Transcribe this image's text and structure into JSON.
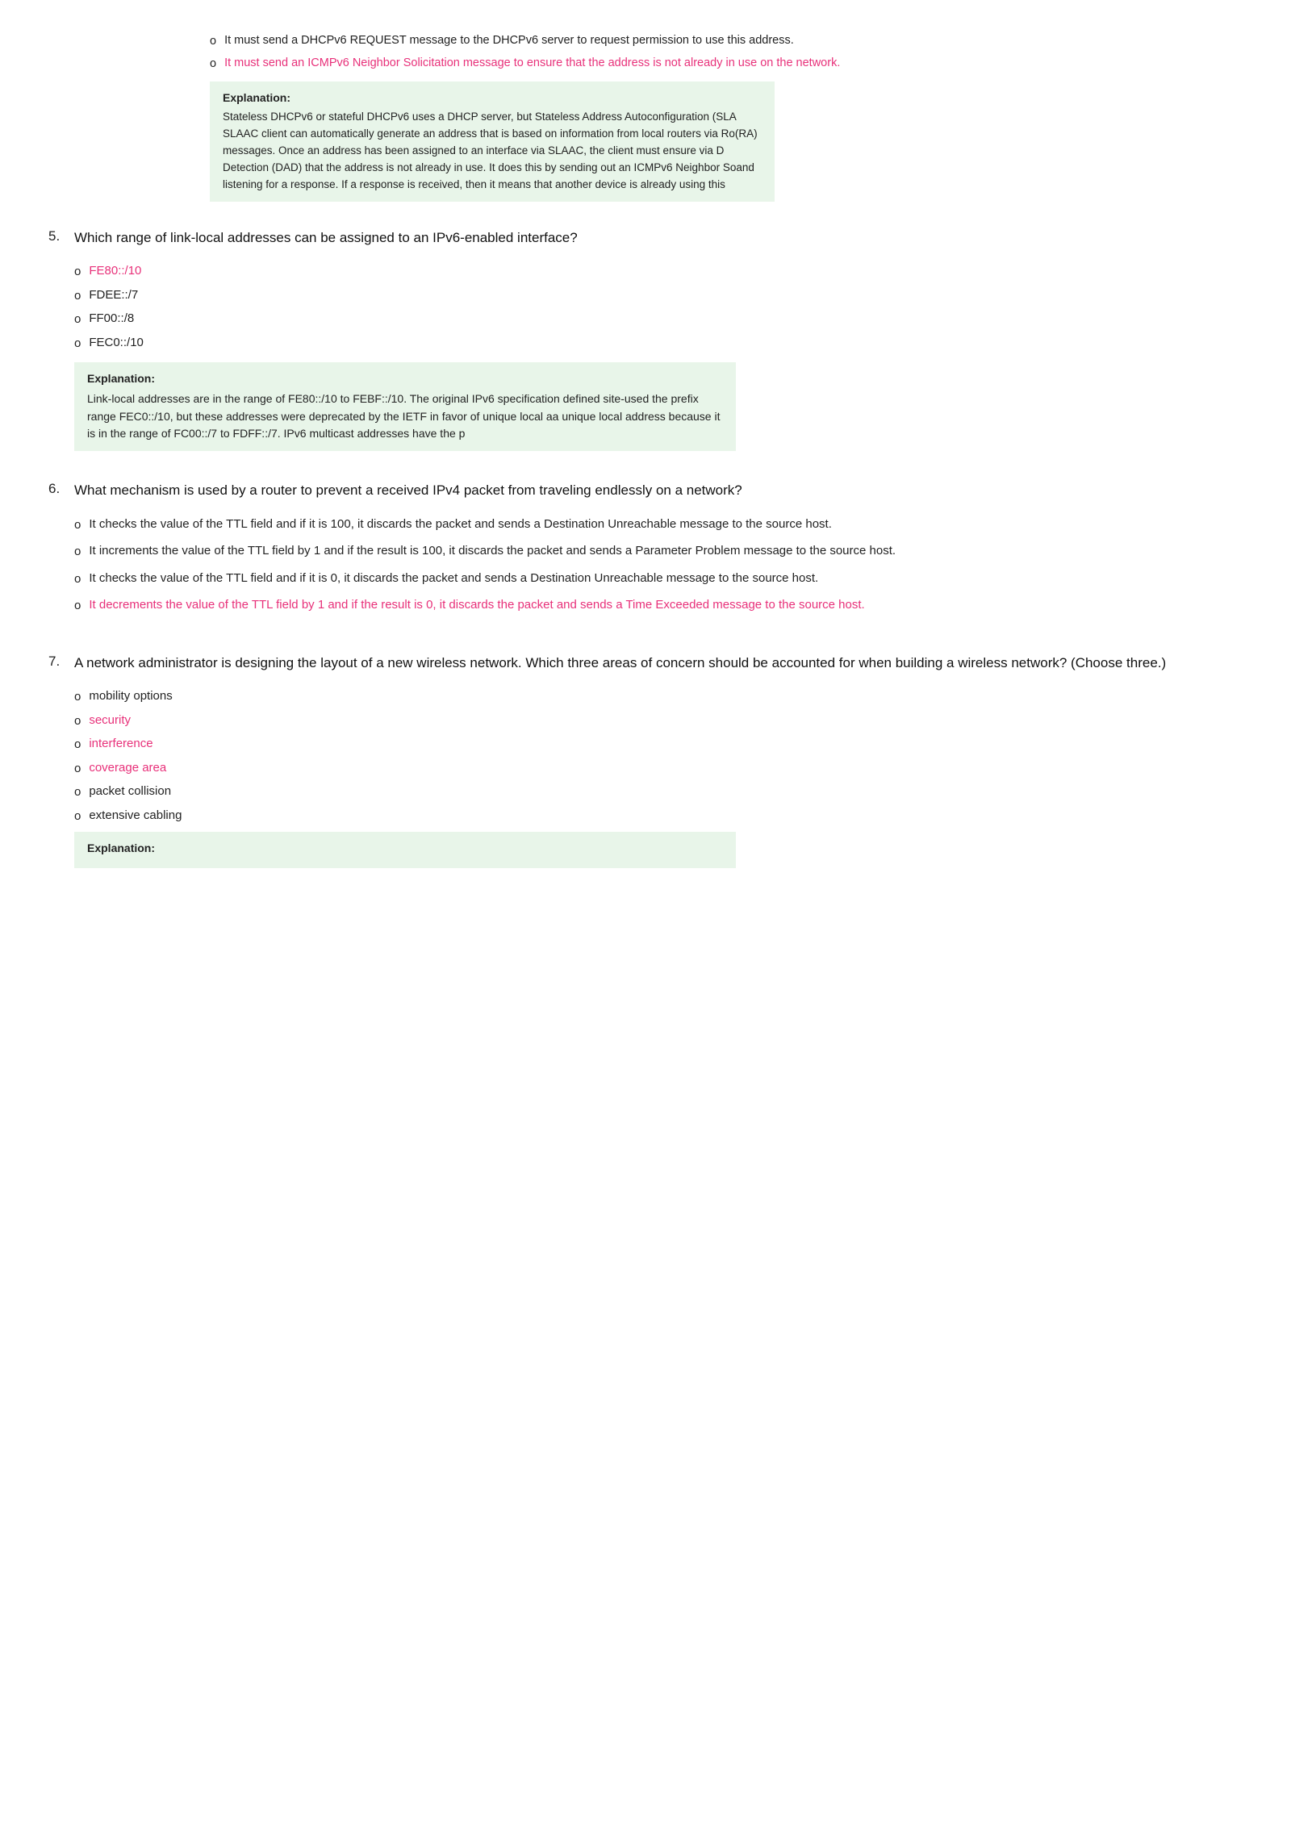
{
  "top_bullets": {
    "items": [
      {
        "id": "b1",
        "text": "It must send a DHCPv6 REQUEST message to the DHCPv6 server to request permission to use this address.",
        "correct": false
      },
      {
        "id": "b2",
        "text": "It must send an ICMPv6 Neighbor Solicitation message to ensure that the address is not already in use on the network.",
        "correct": true
      }
    ],
    "explanation_label": "Explanation:",
    "explanation_text": "Stateless DHCPv6 or stateful DHCPv6 uses a DHCP server, but Stateless Address Autoconfiguration (SLA​​SLAAC client can automatically generate an address that is based on information from local routers via Ro​​(RA) messages. Once an address has been assigned to an interface via SLAAC, the client must ensure via D​Detection (DAD) that the address is not already in use. It does this by sending out an ICMPv6 Neighbor So​and listening for a response. If a response is received, then it means that another device is already using this"
  },
  "q5": {
    "number": "5.",
    "text": "Which range of link-local addresses can be assigned to an IPv6-enabled interface?",
    "answers": [
      {
        "text": "FE80::/10",
        "correct": true
      },
      {
        "text": "FDEE::/7",
        "correct": false
      },
      {
        "text": "FF00::/8",
        "correct": false
      },
      {
        "text": "FEC0::/10",
        "correct": false
      }
    ],
    "explanation_label": "Explanation:",
    "explanation_text": "Link-local addresses are in the range of FE80::/10 to FEBF::/10. The original IPv6 specification defined site-used the prefix range FEC0::/10, but these addresses were deprecated by the IETF in favor of unique local aa unique local address because it is in the range of FC00::/7 to FDFF::/7. IPv6 multicast addresses have the p"
  },
  "q6": {
    "number": "6.",
    "text": "What mechanism is used by a router to prevent a received IPv4 packet from traveling endlessly on a network?",
    "answers": [
      {
        "text": "It checks the value of the TTL field and if it is 100, it discards the packet and sends a Destination Unreachable message to the source host.",
        "correct": false
      },
      {
        "text": "It increments the value of the TTL field by 1 and if the result is 100, it discards the packet and sends a Parameter Problem message to the source host.",
        "correct": false
      },
      {
        "text": "It checks the value of the TTL field and if it is 0, it discards the packet and sends a Destination Unreachable message to the source host.",
        "correct": false
      },
      {
        "text": "It decrements the value of the TTL field by 1 and if the result is 0, it discards the packet and sends a Time Exceeded message to the source host.",
        "correct": true
      }
    ]
  },
  "q7": {
    "number": "7.",
    "text": "A network administrator is designing the layout of a new wireless network. Which three areas of concern should be accounted for when building a wireless network? (Choose three.)",
    "answers": [
      {
        "text": "mobility options",
        "correct": false
      },
      {
        "text": "security",
        "correct": true
      },
      {
        "text": "interference",
        "correct": true
      },
      {
        "text": "coverage area",
        "correct": true
      },
      {
        "text": "packet collision",
        "correct": false
      },
      {
        "text": "extensive cabling",
        "correct": false
      }
    ],
    "explanation_label": "Explanation:",
    "explanation_text": ""
  },
  "bullet_char": "o"
}
